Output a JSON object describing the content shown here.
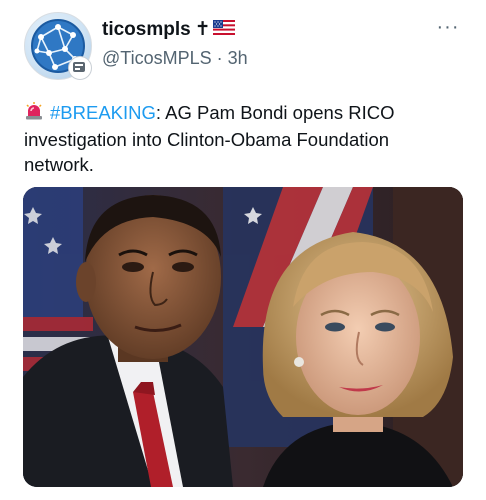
{
  "author": {
    "display_name": "ticosmpls",
    "name_suffix_cross": "✝",
    "name_suffix_flag": "🇺🇸",
    "handle": "@TicosMPLS",
    "separator": "·",
    "timestamp": "3h"
  },
  "tweet": {
    "siren_icon": "police-light-icon",
    "hashtag": "#BREAKING",
    "text_after_hashtag": ": AG Pam Bondi opens RICO investigation into Clinton-Obama Foundation network."
  },
  "more_label": "···",
  "colors": {
    "hashtag_blue": "#1d9bf0",
    "secondary_text": "#536471",
    "primary_text": "#0f1419"
  }
}
